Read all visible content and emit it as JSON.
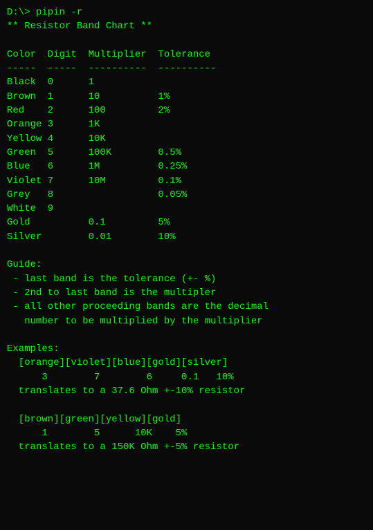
{
  "terminal": {
    "lines": [
      "D:\\> pipin -r",
      "** Resistor Band Chart **",
      "",
      "Color  Digit  Multiplier  Tolerance",
      "-----  -----  ----------  ----------",
      "Black  0      1",
      "Brown  1      10          1%",
      "Red    2      100         2%",
      "Orange 3      1K",
      "Yellow 4      10K",
      "Green  5      100K        0.5%",
      "Blue   6      1M          0.25%",
      "Violet 7      10M         0.1%",
      "Grey   8                  0.05%",
      "White  9",
      "Gold          0.1         5%",
      "Silver        0.01        10%",
      "",
      "Guide:",
      " - last band is the tolerance (+- %)",
      " - 2nd to last band is the multipler",
      " - all other proceeding bands are the decimal",
      "   number to be multiplied by the multiplier",
      "",
      "Examples:",
      "  [orange][violet][blue][gold][silver]",
      "      3        7        6     0.1   10%",
      "  translates to a 37.6 Ohm +-10% resistor",
      "",
      "  [brown][green][yellow][gold]",
      "      1        5      10K    5%",
      "  translates to a 150K Ohm +-5% resistor"
    ]
  }
}
